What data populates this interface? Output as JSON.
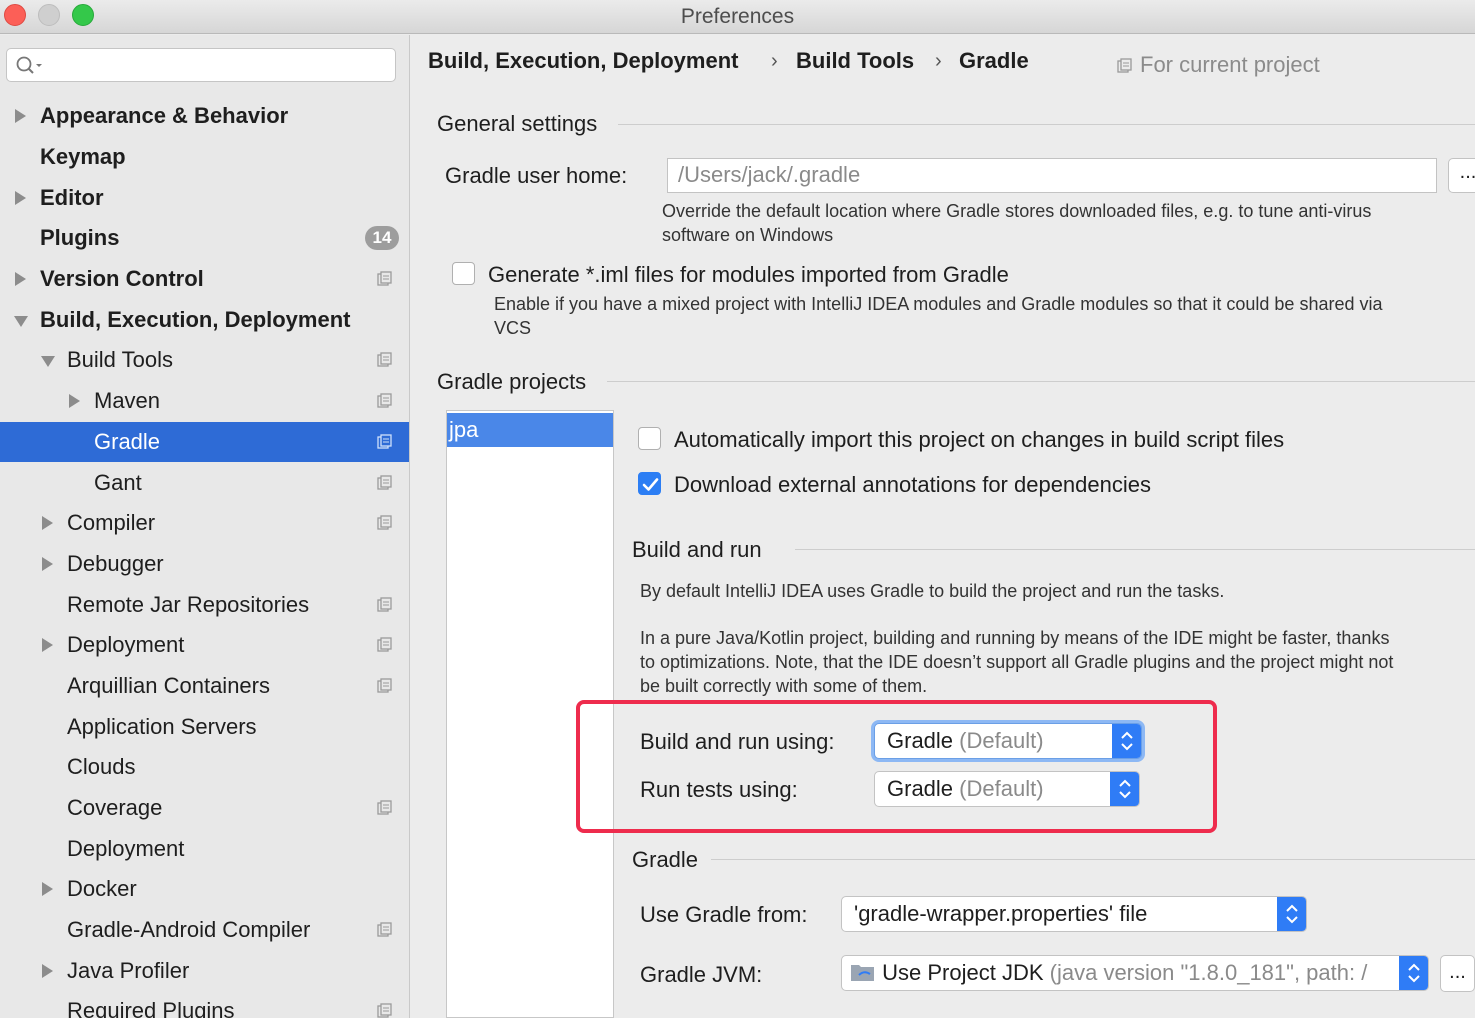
{
  "window": {
    "title": "Preferences"
  },
  "search": {
    "placeholder": ""
  },
  "sidebar": {
    "items": [
      {
        "label": "Appearance & Behavior"
      },
      {
        "label": "Keymap"
      },
      {
        "label": "Editor"
      },
      {
        "label": "Plugins",
        "badge": "14"
      },
      {
        "label": "Version Control"
      },
      {
        "label": "Build, Execution, Deployment"
      },
      {
        "label": "Build Tools"
      },
      {
        "label": "Maven"
      },
      {
        "label": "Gradle"
      },
      {
        "label": "Gant"
      },
      {
        "label": "Compiler"
      },
      {
        "label": "Debugger"
      },
      {
        "label": "Remote Jar Repositories"
      },
      {
        "label": "Deployment"
      },
      {
        "label": "Arquillian Containers"
      },
      {
        "label": "Application Servers"
      },
      {
        "label": "Clouds"
      },
      {
        "label": "Coverage"
      },
      {
        "label": "Deployment"
      },
      {
        "label": "Docker"
      },
      {
        "label": "Gradle-Android Compiler"
      },
      {
        "label": "Java Profiler"
      },
      {
        "label": "Required Plugins"
      }
    ]
  },
  "breadcrumb": {
    "items": [
      "Build, Execution, Deployment",
      "Build Tools",
      "Gradle"
    ],
    "separator": "›"
  },
  "scope": {
    "label": "For current project"
  },
  "general": {
    "title": "General settings",
    "gradle_home_label": "Gradle user home:",
    "gradle_home_placeholder": "/Users/jack/.gradle",
    "gradle_home_hint_1": "Override the default location where Gradle stores downloaded files, e.g. to tune anti-virus",
    "gradle_home_hint_2": "software on Windows",
    "browse_label": "...",
    "iml_label": "Generate *.iml files for modules imported from Gradle",
    "iml_hint_1": "Enable if you have a mixed project with IntelliJ IDEA modules and Gradle modules so that it could be shared via",
    "iml_hint_2": "VCS"
  },
  "projects": {
    "title": "Gradle projects",
    "list": [
      "jpa"
    ],
    "auto_import_label": "Automatically import this project on changes in build script files",
    "download_annotations_label": "Download external annotations for dependencies"
  },
  "build_run": {
    "title": "Build and run",
    "desc_1": "By default IntelliJ IDEA uses Gradle to build the project and run the tasks.",
    "desc_2": "In a pure Java/Kotlin project, building and running by means of the IDE might be faster, thanks",
    "desc_3": "to optimizations. Note, that the IDE doesn’t support all Gradle plugins and the project might not",
    "desc_4": "be built correctly with some of them.",
    "build_using_label": "Build and run using:",
    "build_using_value": "Gradle",
    "build_using_suffix": "(Default)",
    "tests_using_label": "Run tests using:",
    "tests_using_value": "Gradle",
    "tests_using_suffix": "(Default)"
  },
  "gradle": {
    "title": "Gradle",
    "use_from_label": "Use Gradle from:",
    "use_from_value": "'gradle-wrapper.properties' file",
    "jvm_label": "Gradle JVM:",
    "jvm_value": "Use Project JDK",
    "jvm_suffix": "(java version \"1.8.0_181\", path: /",
    "browse_label": "..."
  },
  "colors": {
    "accent": "#2e6bd6",
    "highlight_box": "#ee2c4d",
    "checkbox_blue": "#2c7ef4"
  }
}
